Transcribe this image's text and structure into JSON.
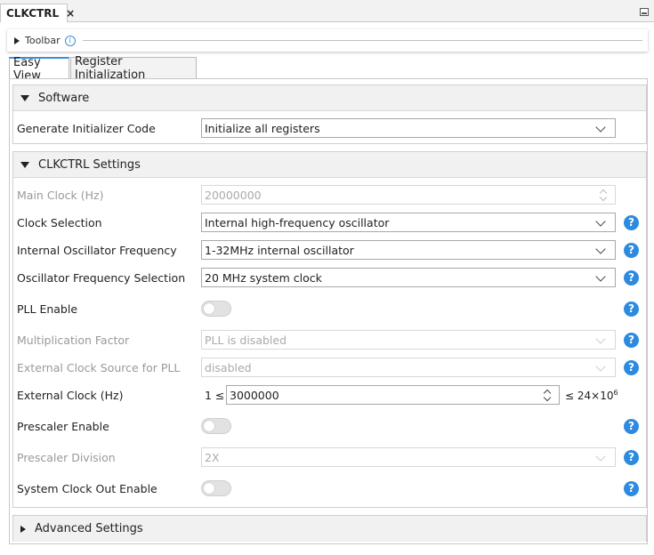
{
  "view_tab": {
    "title": "CLKCTRL",
    "close": "×"
  },
  "toolbar": {
    "label": "Toolbar",
    "info": "i"
  },
  "tabs": [
    {
      "label": "Easy View",
      "active": true
    },
    {
      "label": "Register Initialization",
      "active": false
    }
  ],
  "software": {
    "title": "Software",
    "generate": {
      "label": "Generate Initializer Code",
      "value": "Initialize all registers"
    }
  },
  "clkctrl": {
    "title": "CLKCTRL Settings",
    "main_clock": {
      "label": "Main Clock (Hz)",
      "value": "20000000"
    },
    "clock_selection": {
      "label": "Clock Selection",
      "value": "Internal high-frequency oscillator"
    },
    "internal_osc_freq": {
      "label": "Internal Oscillator Frequency",
      "value": "1-32MHz internal oscillator"
    },
    "osc_freq_selection": {
      "label": "Oscillator Frequency Selection",
      "value": "20 MHz system clock"
    },
    "pll_enable": {
      "label": "PLL Enable",
      "on": false
    },
    "multiplication_factor": {
      "label": "Multiplication Factor",
      "value": "PLL is disabled"
    },
    "ext_clock_source_pll": {
      "label": "External Clock Source for PLL",
      "value": "disabled"
    },
    "external_clock": {
      "label": "External Clock (Hz)",
      "prefix": "1 ≤",
      "value": "3000000",
      "suffix": "≤ 24×10",
      "suffix_exp": "6"
    },
    "prescaler_enable": {
      "label": "Prescaler Enable",
      "on": false
    },
    "prescaler_division": {
      "label": "Prescaler Division",
      "value": "2X"
    },
    "sysclk_out_enable": {
      "label": "System Clock Out Enable",
      "on": false
    },
    "help": "?"
  },
  "advanced": {
    "title": "Advanced Settings"
  }
}
